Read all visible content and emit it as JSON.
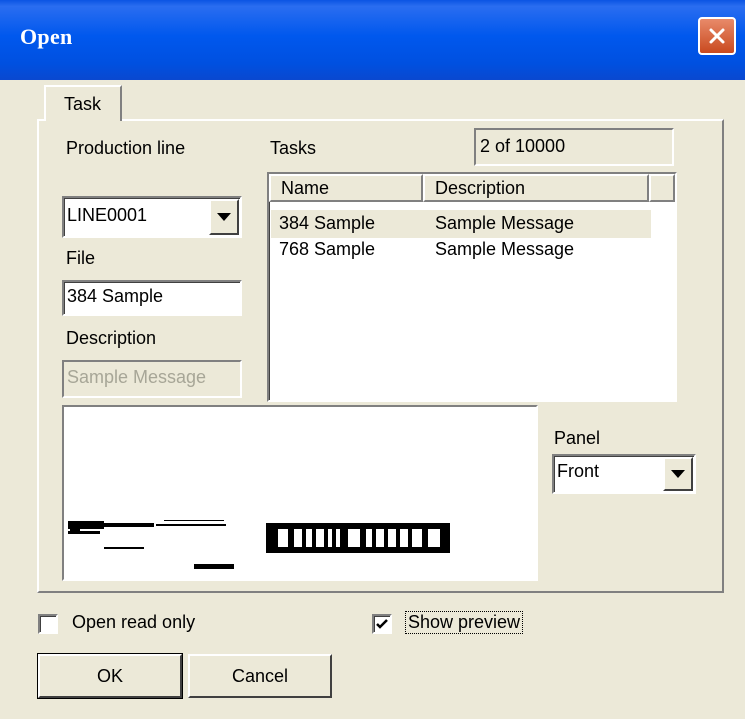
{
  "window": {
    "title": "Open"
  },
  "tabs": [
    {
      "label": "Task"
    }
  ],
  "production_line": {
    "label": "Production line",
    "value": "LINE0001"
  },
  "file": {
    "label": "File",
    "value": "384 Sample"
  },
  "description": {
    "label": "Description",
    "placeholder": "Sample Message"
  },
  "tasks": {
    "label": "Tasks",
    "count": "2 of 10000",
    "columns": [
      "Name",
      "Description"
    ],
    "rows": [
      {
        "name": "384 Sample",
        "description": "Sample Message"
      },
      {
        "name": "768 Sample",
        "description": "Sample Message"
      }
    ]
  },
  "panel": {
    "label": "Panel",
    "value": "Front"
  },
  "options": {
    "open_read_only": "Open read only",
    "open_read_only_checked": false,
    "show_preview": "Show preview",
    "show_preview_checked": true
  },
  "buttons": {
    "ok": "OK",
    "cancel": "Cancel"
  },
  "icons": [
    "close-icon",
    "dropdown-arrow-icon",
    "checkmark-icon"
  ],
  "colors": {
    "titlebar": "#0058ee",
    "face": "#ece9d8",
    "close": "#c94a1f",
    "selected_row": "#ece9d8"
  }
}
